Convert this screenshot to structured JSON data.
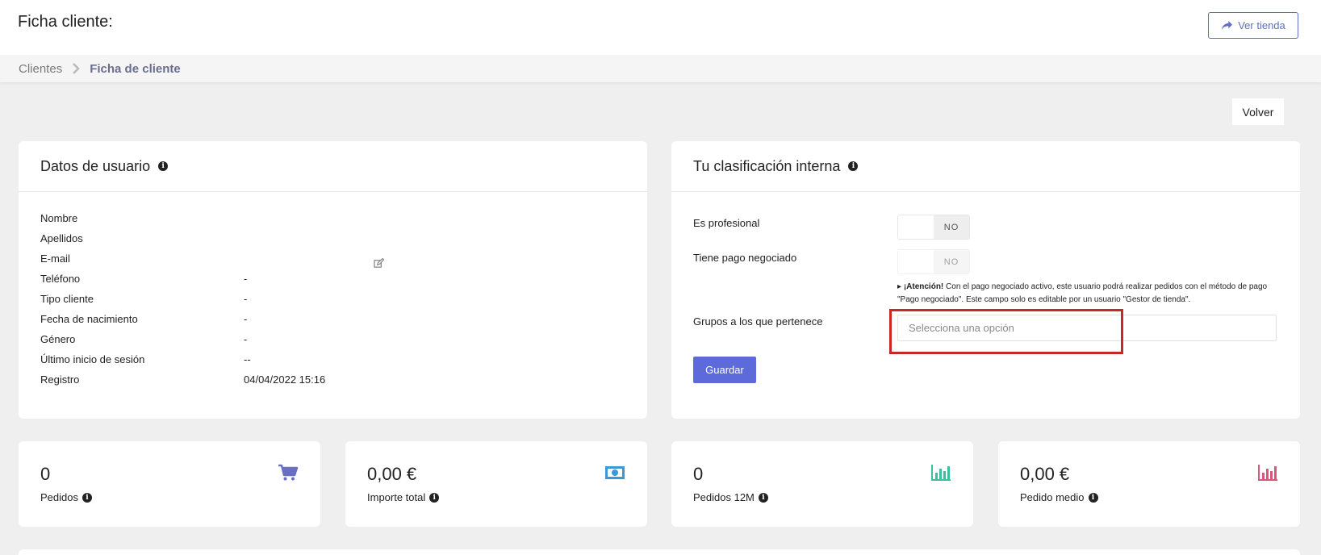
{
  "header": {
    "title": "Ficha cliente:",
    "ver_tienda_label": "Ver tienda"
  },
  "breadcrumb": {
    "items": [
      "Clientes",
      "Ficha de cliente"
    ]
  },
  "actions": {
    "volver_label": "Volver"
  },
  "user_card": {
    "title": "Datos de usuario",
    "fields": [
      {
        "label": "Nombre",
        "value": ""
      },
      {
        "label": "Apellidos",
        "value": ""
      },
      {
        "label": "E-mail",
        "value": ""
      },
      {
        "label": "Teléfono",
        "value": "-"
      },
      {
        "label": "Tipo cliente",
        "value": "-"
      },
      {
        "label": "Fecha de nacimiento",
        "value": "-"
      },
      {
        "label": "Género",
        "value": "-"
      },
      {
        "label": "Último inicio de sesión",
        "value": "--"
      },
      {
        "label": "Registro",
        "value": "04/04/2022 15:16"
      }
    ]
  },
  "classification_card": {
    "title": "Tu clasificación interna",
    "es_profesional_label": "Es profesional",
    "es_profesional_toggle": "NO",
    "pago_negociado_label": "Tiene pago negociado",
    "pago_negociado_toggle": "NO",
    "attention_strong": "¡Atención!",
    "attention_text": "Con el pago negociado activo, este usuario podrá realizar pedidos con el método de pago \"Pago negociado\". Este campo solo es editable por un usuario \"Gestor de tienda\".",
    "grupos_label": "Grupos a los que pertenece",
    "grupos_placeholder": "Selecciona una opción",
    "guardar_label": "Guardar"
  },
  "stats": [
    {
      "value": "0",
      "label": "Pedidos",
      "icon": "cart-icon",
      "color": "#6a6fc6"
    },
    {
      "value": "0,00 €",
      "label": "Importe total",
      "icon": "money-icon",
      "color": "#3a9ad9"
    },
    {
      "value": "0",
      "label": "Pedidos 12M",
      "icon": "bar-chart-icon",
      "color": "#3bbfa0"
    },
    {
      "value": "0,00 €",
      "label": "Pedido medio",
      "icon": "bar-chart-icon",
      "color": "#d9577a"
    }
  ]
}
